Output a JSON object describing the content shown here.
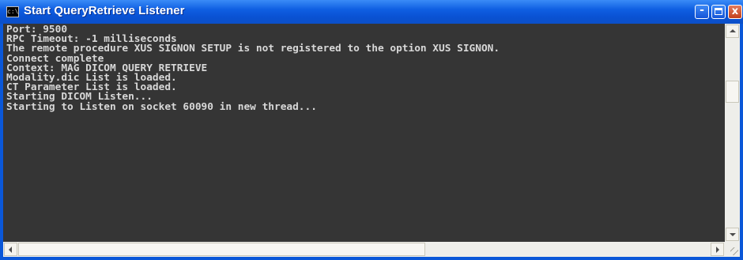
{
  "window": {
    "title": "Start QueryRetrieve Listener",
    "icon_text": "c:\\",
    "controls": {
      "minimize": "-",
      "maximize": "maximize",
      "close": "x"
    }
  },
  "console": {
    "lines": [
      "Port: 9500",
      "RPC Timeout: -1 milliseconds",
      "The remote procedure XUS SIGNON SETUP is not registered to the option XUS SIGNON.",
      "Connect complete",
      "Context: MAG DICOM QUERY RETRIEVE",
      "Modality.dic List is loaded.",
      "CT Parameter List is loaded.",
      "Starting DICOM Listen...",
      "Starting to Listen on socket 60090 in new thread..."
    ]
  },
  "icons": [
    "console-app-icon",
    "minimize-icon",
    "maximize-icon",
    "close-icon",
    "scroll-up-icon",
    "scroll-down-icon",
    "scroll-left-icon",
    "scroll-right-icon",
    "resize-grip-icon"
  ]
}
